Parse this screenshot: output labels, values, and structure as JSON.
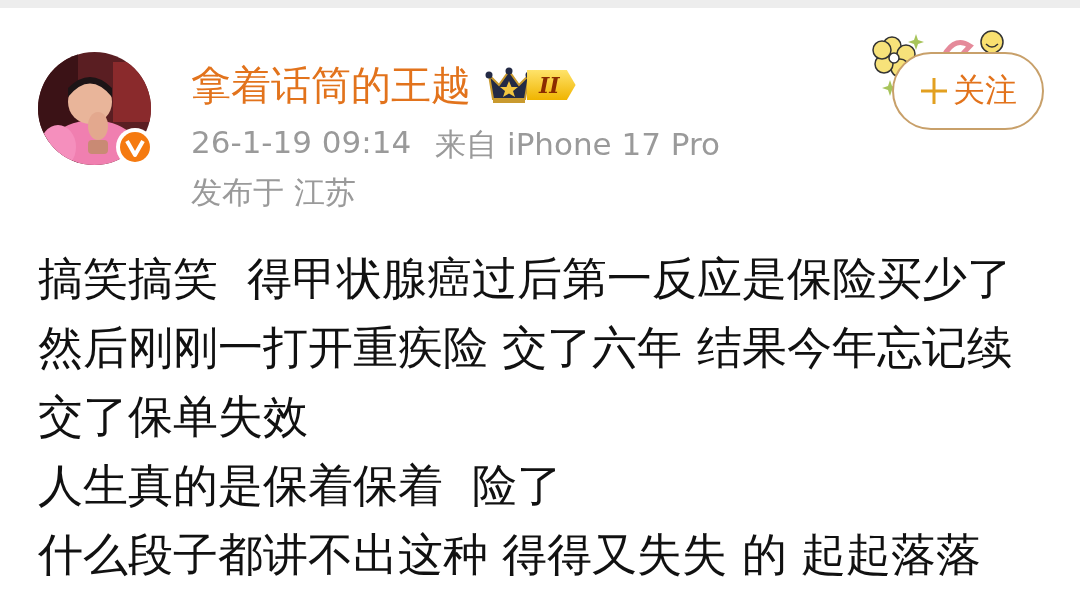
{
  "post": {
    "author": {
      "name": "拿着话筒的王越",
      "verified": true,
      "level_badge": "II"
    },
    "time": "26-1-19 09:14",
    "source": "来自 iPhone 17 Pro",
    "location": "发布于 江苏",
    "follow_button": {
      "label": "关注",
      "following": false
    },
    "lines": [
      "搞笑搞笑  得甲状腺癌过后第一反应是保险买少了",
      "然后刚刚一打开重疾险 交了六年 结果今年忘记续",
      "交了保单失效",
      "人生真的是保着保着  险了",
      "什么段子都讲不出这种 得得又失失 的 起起落落"
    ]
  }
}
